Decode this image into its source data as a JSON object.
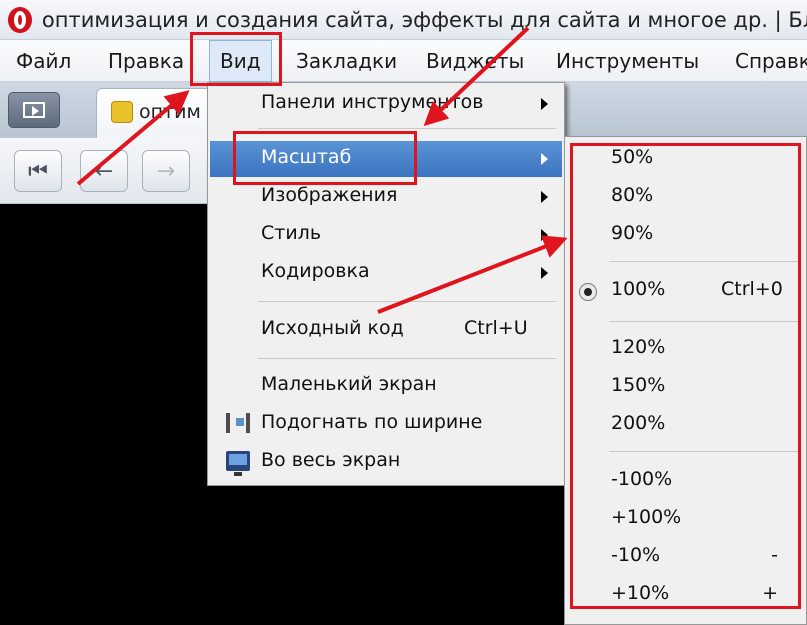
{
  "window": {
    "title": "оптимизация и создания сайта, эффекты для сайта и многое др. | Блог Ко"
  },
  "menubar": {
    "items": [
      "Файл",
      "Правка",
      "Вид",
      "Закладки",
      "Виджеты",
      "Инструменты",
      "Справк"
    ],
    "active_index": 2
  },
  "tab": {
    "title": "оптим"
  },
  "nav": {
    "buttons": [
      "rewind-icon",
      "back-icon",
      "forward-icon"
    ]
  },
  "view_menu": {
    "items": [
      {
        "label": "Панели инструментов",
        "submenu": true
      },
      {
        "label": "Масштаб",
        "submenu": true,
        "highlighted": true
      },
      {
        "label": "Изображения",
        "submenu": true
      },
      {
        "label": "Стиль",
        "submenu": true
      },
      {
        "label": "Кодировка",
        "submenu": true
      },
      {
        "label": "Исходный код",
        "shortcut": "Ctrl+U"
      },
      {
        "label": "Маленький экран"
      },
      {
        "label": "Подогнать по ширине",
        "icon": "fit-width-icon"
      },
      {
        "label": "Во весь экран",
        "icon": "fullscreen-icon"
      }
    ]
  },
  "zoom_menu": {
    "items": [
      {
        "label": "50%"
      },
      {
        "label": "80%"
      },
      {
        "label": "90%"
      },
      {
        "label": "100%",
        "shortcut": "Ctrl+0",
        "checked": true
      },
      {
        "label": "120%"
      },
      {
        "label": "150%"
      },
      {
        "label": "200%"
      },
      {
        "label": "-100%"
      },
      {
        "label": "+100%"
      },
      {
        "label": "-10%",
        "shortcut": "-"
      },
      {
        "label": "+10%",
        "shortcut": "+"
      }
    ]
  },
  "colors": {
    "annotation": "#e0141c",
    "highlight": "#3b73c0",
    "opera": "#d0101a"
  }
}
